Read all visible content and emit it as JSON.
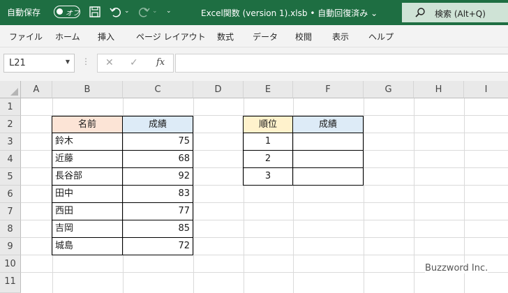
{
  "titlebar": {
    "autosave_label": "自動保存",
    "autosave_state": "オフ",
    "document_title": "Excel関数 (version 1).xlsb",
    "save_status": "自動回復済み",
    "search_label": "検索 (Alt+Q)",
    "accent_color": "#1e6e42"
  },
  "ribbon": {
    "tabs": [
      "ファイル",
      "ホーム",
      "挿入",
      "ページ レイアウト",
      "数式",
      "データ",
      "校閲",
      "表示",
      "ヘルプ"
    ]
  },
  "formula_bar": {
    "name_box": "L21",
    "formula": ""
  },
  "sheet": {
    "columns": [
      "A",
      "B",
      "C",
      "D",
      "E",
      "F",
      "G",
      "H",
      "I"
    ],
    "rows": [
      "1",
      "2",
      "3",
      "4",
      "5",
      "6",
      "7",
      "8",
      "9",
      "10",
      "11"
    ],
    "table1": {
      "header_name": "名前",
      "header_score": "成績",
      "rows": [
        {
          "name": "鈴木",
          "score": "75"
        },
        {
          "name": "近藤",
          "score": "68"
        },
        {
          "name": "長谷部",
          "score": "92"
        },
        {
          "name": "田中",
          "score": "83"
        },
        {
          "name": "西田",
          "score": "77"
        },
        {
          "name": "吉岡",
          "score": "85"
        },
        {
          "name": "城島",
          "score": "72"
        }
      ]
    },
    "table2": {
      "header_rank": "順位",
      "header_score": "成績",
      "rows": [
        {
          "rank": "1",
          "score": ""
        },
        {
          "rank": "2",
          "score": ""
        },
        {
          "rank": "3",
          "score": ""
        }
      ]
    }
  },
  "watermark": "Buzzword Inc."
}
